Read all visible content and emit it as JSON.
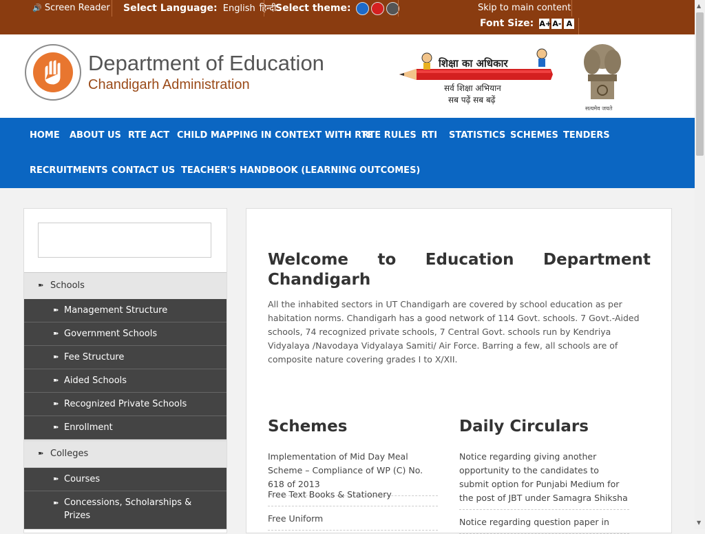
{
  "topbar": {
    "screen_reader": "Screen Reader",
    "select_language_label": "Select Language:",
    "language_english": "English",
    "language_hindi": "हिन्दी",
    "select_theme_label": "Select theme:",
    "theme_colors": [
      "#1e6ac8",
      "#d42020",
      "#555555"
    ],
    "skip_link": "Skip to main content",
    "font_size_label": "Font Size:",
    "font_buttons": [
      "A+",
      "A-",
      "A"
    ]
  },
  "header": {
    "dept_title": "Department of Education",
    "dept_subtitle": "Chandigarh Administration",
    "rte_title": "शिक्षा का अधिकार",
    "rte_line1": "सर्व शिक्षा अभियान",
    "rte_line2": "सब पढ़ें सब बढ़ें",
    "emblem_caption": "सत्यमेव जयते"
  },
  "nav": {
    "items": [
      "HOME",
      "ABOUT US",
      "RTE ACT",
      "CHILD MAPPING IN CONTEXT WITH RTE",
      "RTE RULES",
      "RTI",
      "STATISTICS",
      "SCHEMES",
      "TENDERS",
      "RECRUITMENTS",
      "CONTACT US",
      "TEACHER'S HANDBOOK (LEARNING OUTCOMES)"
    ]
  },
  "sidebar": {
    "arrow": "➽",
    "categories": [
      "Schools",
      "Colleges"
    ],
    "schools_items": [
      "Management Structure",
      "Government Schools",
      "Fee Structure",
      "Aided Schools",
      "Recognized Private Schools",
      "Enrollment"
    ],
    "colleges_items": [
      "Courses",
      "Concessions, Scholarships & Prizes"
    ]
  },
  "main": {
    "welcome_line1": "Welcome to Education Department",
    "welcome_line2": "Chandigarh",
    "intro": "All the inhabited sectors in UT Chandigarh are covered by school education as per habitation norms. Chandigarh has a good network of 114 Govt. schools. 7 Govt.-Aided schools, 74 recognized private schools, 7 Central Govt. schools run by Kendriya Vidyalaya /Navodaya Vidyalaya Samiti/ Air Force. Barring a few, all schools are of composite nature covering grades I to X/XII.",
    "schemes_title": "Schemes",
    "schemes": [
      "Implementation of Mid Day Meal Scheme – Compliance of WP (C) No. 618 of 2013",
      "Free Text Books & Stationery",
      "Free Uniform"
    ],
    "circulars_title": "Daily Circulars",
    "circulars": [
      "Notice regarding giving another opportunity to the candidates to submit option for Punjabi Medium for the post of JBT under Samagra Shiksha",
      "Notice regarding question paper in"
    ]
  }
}
